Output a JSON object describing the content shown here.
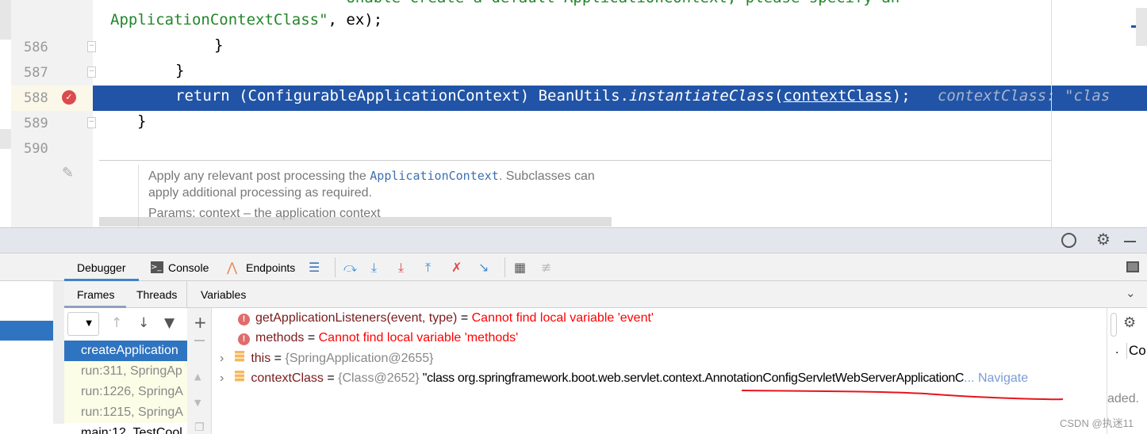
{
  "editor": {
    "lines": [
      {
        "num": "",
        "text_partial": "\"Unable create a default ApplicationContext, please specify an"
      },
      {
        "num": "",
        "text": "ApplicationContextClass\", ex);"
      },
      {
        "num": "586",
        "text": "}"
      },
      {
        "num": "587",
        "text": "}"
      },
      {
        "num": "588",
        "kw": "return",
        "cast": "(ConfigurableApplicationContext) BeanUtils.",
        "method": "instantiateClass",
        "paren_open": "(",
        "arg": "contextClass",
        "end": ");",
        "hint": "contextClass: \"clas"
      },
      {
        "num": "589",
        "text": "}"
      },
      {
        "num": "590",
        "text": ""
      }
    ],
    "doc_popup": {
      "line1_pre": "Apply any relevant post processing the ",
      "line1_code": "ApplicationContext",
      "line1_post": ". Subclasses can",
      "line2": "apply additional processing as required.",
      "params": "Params: context – the application context"
    },
    "highlight_color": "#2154a6"
  },
  "debug": {
    "tabs": [
      "Debugger",
      "Console",
      "Endpoints"
    ],
    "subtabs": [
      "Frames",
      "Threads"
    ],
    "variables_label": "Variables",
    "frames": [
      "createApplication",
      "run:311, SpringAp",
      "run:1226, SpringA",
      "run:1215, SpringA",
      "main:12, TestCool"
    ],
    "variables": [
      {
        "name": "getApplicationListeners(event, type)",
        "eq": " = ",
        "value": "Cannot find local variable 'event'",
        "type": "error"
      },
      {
        "name": "methods",
        "eq": " = ",
        "value": "Cannot find local variable 'methods'",
        "type": "error"
      },
      {
        "name": "this",
        "eq": " = ",
        "ref": "{SpringApplication@2655}",
        "type": "object"
      },
      {
        "name": "contextClass",
        "eq": " = ",
        "ref": "{Class@2652}",
        "value": " \"class org.springframework.boot.web.servlet.context.AnnotationConfigServletWebServerApplicationC",
        "ellipsis": "...",
        "link": "Navigate",
        "type": "object"
      }
    ],
    "right_panel": {
      "item": "Co",
      "dot": ".",
      "status": "aded."
    }
  },
  "watermark": "CSDN @执迷11"
}
